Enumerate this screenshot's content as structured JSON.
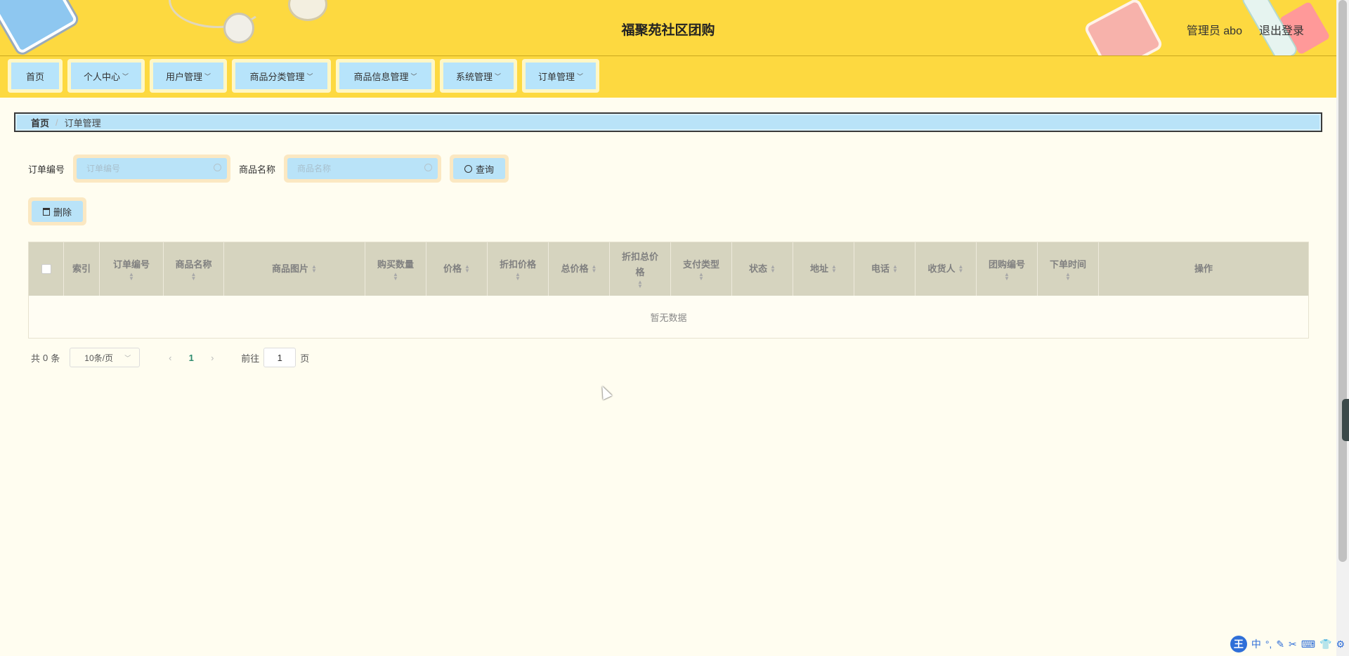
{
  "header": {
    "site_title": "福聚苑社区团购",
    "user_label": "管理员 abo",
    "logout_label": "退出登录"
  },
  "nav": {
    "items": [
      {
        "label": "首页",
        "has_dropdown": false
      },
      {
        "label": "个人中心",
        "has_dropdown": true
      },
      {
        "label": "用户管理",
        "has_dropdown": true
      },
      {
        "label": "商品分类管理",
        "has_dropdown": true
      },
      {
        "label": "商品信息管理",
        "has_dropdown": true
      },
      {
        "label": "系统管理",
        "has_dropdown": true
      },
      {
        "label": "订单管理",
        "has_dropdown": true
      }
    ]
  },
  "breadcrumb": {
    "home": "首页",
    "separator": "/",
    "current": "订单管理"
  },
  "search": {
    "order_no_label": "订单编号",
    "order_no_placeholder": "订单编号",
    "order_no_value": "",
    "product_name_label": "商品名称",
    "product_name_placeholder": "商品名称",
    "product_name_value": "",
    "query_label": "查询"
  },
  "actions": {
    "delete_label": "删除"
  },
  "table": {
    "columns": [
      {
        "label": "",
        "type": "checkbox"
      },
      {
        "label": "索引",
        "sortable": false
      },
      {
        "label": "订单编号",
        "sortable": true
      },
      {
        "label": "商品名称",
        "sortable": true
      },
      {
        "label": "商品图片",
        "sortable": true
      },
      {
        "label": "购买数量",
        "sortable": true
      },
      {
        "label": "价格",
        "sortable": true
      },
      {
        "label": "折扣价格",
        "sortable": true
      },
      {
        "label": "总价格",
        "sortable": true
      },
      {
        "label": "折扣总价格",
        "sortable": true
      },
      {
        "label": "支付类型",
        "sortable": true
      },
      {
        "label": "状态",
        "sortable": true
      },
      {
        "label": "地址",
        "sortable": true
      },
      {
        "label": "电话",
        "sortable": true
      },
      {
        "label": "收货人",
        "sortable": true
      },
      {
        "label": "团购编号",
        "sortable": true
      },
      {
        "label": "下单时间",
        "sortable": true
      },
      {
        "label": "操作",
        "sortable": false
      }
    ],
    "rows": [],
    "empty_text": "暂无数据"
  },
  "pagination": {
    "total_prefix": "共",
    "total_count": "0",
    "total_suffix": "条",
    "page_size": "10条/页",
    "current_page": "1",
    "goto_prefix": "前往",
    "goto_value": "1",
    "goto_suffix": "页"
  },
  "ime": {
    "logo": "王",
    "mode": "中"
  },
  "colors": {
    "header_bg": "#fdd940",
    "button_bg": "#b9e3f8",
    "table_header_bg": "#d6d4bf",
    "page_bg": "#fffdf0"
  }
}
